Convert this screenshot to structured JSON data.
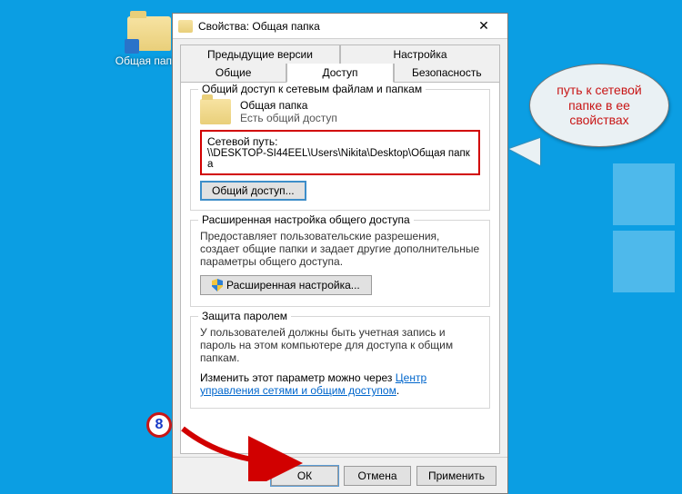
{
  "desktop": {
    "icon_label": "Общая папка"
  },
  "dialog": {
    "title": "Свойства: Общая папка",
    "tabs": {
      "row1": [
        "Предыдущие версии",
        "Настройка"
      ],
      "row2": [
        "Общие",
        "Доступ",
        "Безопасность"
      ],
      "active_index": 1
    },
    "sharing": {
      "legend": "Общий доступ к сетевым файлам и папкам",
      "folder_name": "Общая папка",
      "status": "Есть общий доступ",
      "path_label": "Сетевой путь:",
      "path_value": "\\\\DESKTOP-SI44EEL\\Users\\Nikita\\Desktop\\Общая папка",
      "share_button": "Общий доступ..."
    },
    "advanced": {
      "legend": "Расширенная настройка общего доступа",
      "description": "Предоставляет пользовательские разрешения, создает общие папки и задает другие дополнительные параметры общего доступа.",
      "button": "Расширенная настройка..."
    },
    "password": {
      "legend": "Защита паролем",
      "description": "У пользователей должны быть учетная запись и пароль на этом компьютере для доступа к общим папкам.",
      "change_prefix": "Изменить этот параметр можно через ",
      "link_text": "Центр управления сетями и общим доступом",
      "suffix": "."
    },
    "buttons": {
      "ok": "ОК",
      "cancel": "Отмена",
      "apply": "Применить"
    }
  },
  "annotations": {
    "callout_text": "путь к сетевой папке в ее свойствах",
    "step_number": "8"
  }
}
